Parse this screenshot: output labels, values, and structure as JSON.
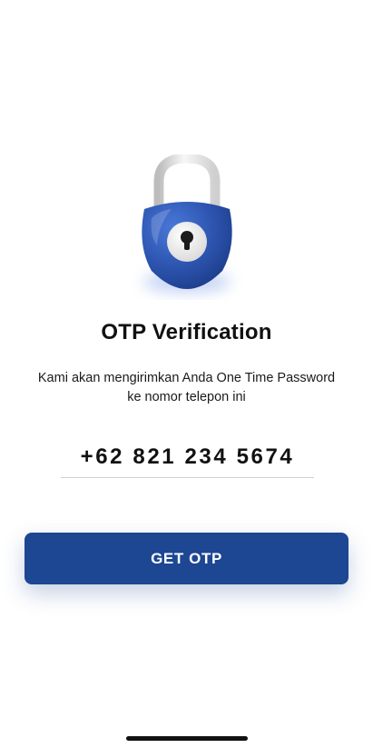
{
  "screen": {
    "title": "OTP Verification",
    "subtitle_line1": "Kami akan mengirimkan Anda One Time Password",
    "subtitle_line2": "ke nomor telepon ini"
  },
  "phone": {
    "value": "+62 821 234 5674"
  },
  "actions": {
    "get_otp_label": "GET OTP"
  },
  "icons": {
    "hero": "padlock-icon",
    "keyhole": "keyhole-icon"
  },
  "colors": {
    "primary": "#1d4693",
    "lock_body": "#2d55b0",
    "background": "#ffffff",
    "text": "#111111"
  }
}
